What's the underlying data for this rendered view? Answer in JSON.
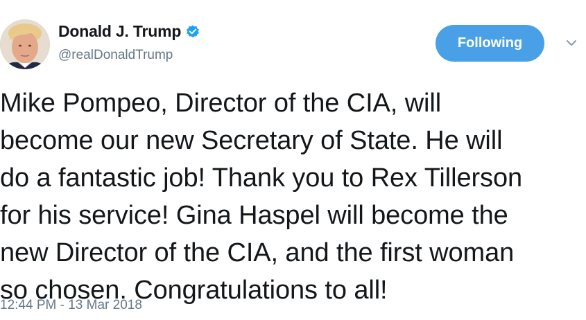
{
  "author": {
    "display_name": "Donald J. Trump",
    "handle": "@realDonaldTrump",
    "verified": true
  },
  "actions": {
    "follow_label": "Following"
  },
  "tweet": {
    "text": "Mike Pompeo, Director of the CIA, will\nbecome our new Secretary of State. He will\ndo a fantastic job! Thank you to Rex Tillerson\nfor his service! Gina Haspel will become the\nnew Director of the CIA, and the first woman\nso chosen. Congratulations to all!",
    "timestamp": "12:44 PM - 13 Mar 2018"
  },
  "icons": {
    "verified": "verified-badge-icon",
    "menu": "chevron-down-icon"
  },
  "colors": {
    "accent": "#4aa0e6",
    "verified": "#1da1f2",
    "text": "#14171a",
    "muted": "#657786"
  }
}
